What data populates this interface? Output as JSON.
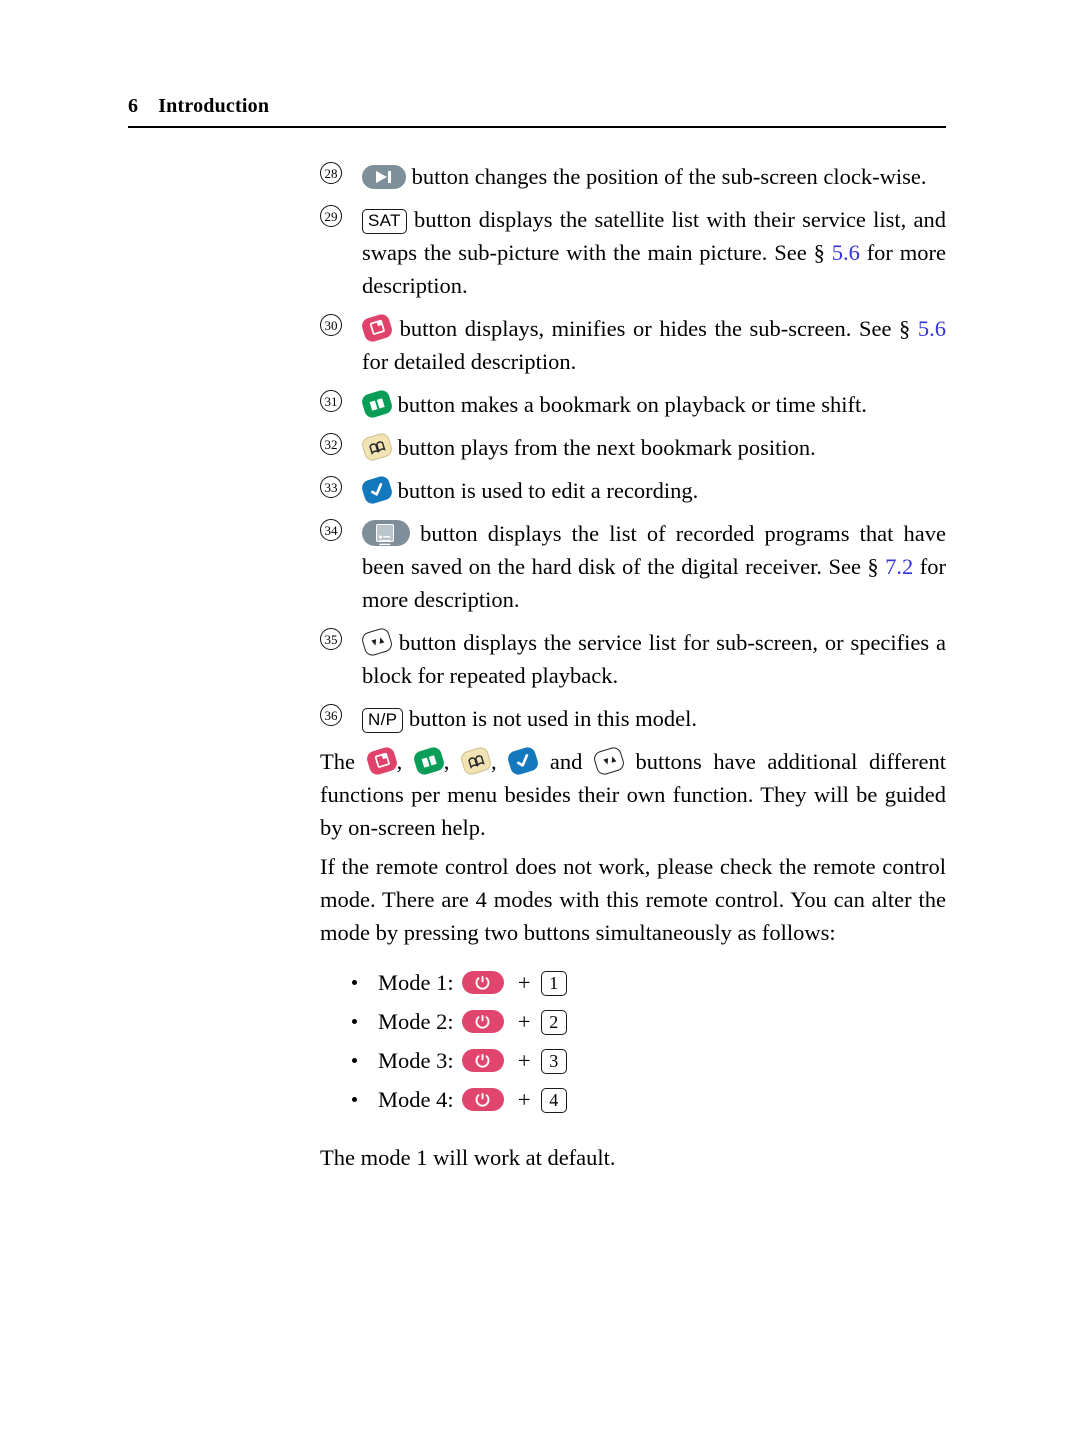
{
  "header": {
    "folio": "6",
    "chapter": "Introduction"
  },
  "items": [
    {
      "number": "28",
      "icon": "skip-next-button-icon",
      "text_before": "",
      "text_after": "button changes the position of the sub-screen clock-wise."
    },
    {
      "number": "29",
      "icon": "sat-keycap",
      "keycap": "SAT",
      "text_after_1": "button displays the satellite list with their service list, and swaps the sub-picture with the main picture. See §",
      "link": "5.6",
      "text_after_2": "for more description."
    },
    {
      "number": "30",
      "icon": "pink-sub-screen-button-icon",
      "text_after_1": "button displays, minifies or hides the sub-screen. See §",
      "link": "5.6",
      "text_after_2": "for detailed description."
    },
    {
      "number": "31",
      "icon": "green-bookmark-button-icon",
      "text_after": "button makes a bookmark on playback or time shift."
    },
    {
      "number": "32",
      "icon": "cream-bookmark-jump-button-icon",
      "text_after": "button plays from the next bookmark position."
    },
    {
      "number": "33",
      "icon": "blue-check-edit-button-icon",
      "text_after": "button is used to edit a recording."
    },
    {
      "number": "34",
      "icon": "recorded-programs-list-button-icon",
      "text_after_1": "button displays the list of recorded programs that have been saved on the hard disk of the digital receiver. See §",
      "link": "7.2",
      "text_after_2": "for more description."
    },
    {
      "number": "35",
      "icon": "white-arrows-service-list-button-icon",
      "text_after": "button displays the service list for sub-screen, or specifies a block for repeated playback."
    },
    {
      "number": "36",
      "icon": "np-keycap",
      "keycap": "N/P",
      "text_after": "button is not used in this model."
    }
  ],
  "paragraphs": {
    "additional_functions_lead": "The",
    "additional_functions_tail": "buttons have additional different functions per menu besides their own function. They will be guided by on-screen help.",
    "remote_mode": "If the remote control does not work, please check the remote control mode. There are 4 modes with this remote control. You can alter the mode by pressing two buttons simultaneously as follows:",
    "closing": "The mode 1 will work at default."
  },
  "modes": [
    {
      "label": "Mode 1:",
      "power_icon": "power-button-icon",
      "plus": "+",
      "key": "1"
    },
    {
      "label": "Mode 2:",
      "power_icon": "power-button-icon",
      "plus": "+",
      "key": "2"
    },
    {
      "label": "Mode 3:",
      "power_icon": "power-button-icon",
      "plus": "+",
      "key": "3"
    },
    {
      "label": "Mode 4:",
      "power_icon": "power-button-icon",
      "plus": "+",
      "key": "4"
    }
  ],
  "colors": {
    "pill_grey": "#7f8f9a",
    "pink": "#e0426a",
    "green": "#0a9d57",
    "cream": "#f1e3b3",
    "blue": "#1478bd",
    "power_pink": "#e0456e",
    "link": "#3333dd"
  }
}
